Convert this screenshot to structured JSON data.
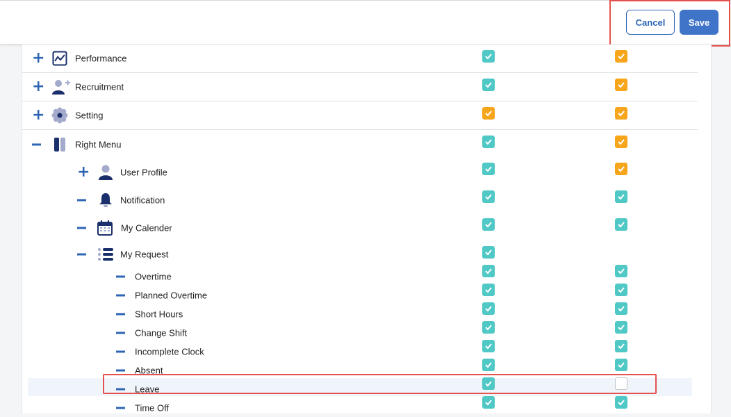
{
  "header": {
    "cancel_label": "Cancel",
    "save_label": "Save"
  },
  "colors": {
    "primary": "#3f74c8",
    "teal_checked": "#4fc8c6",
    "orange_checked": "#f7a51b",
    "highlight_red": "#e4514f"
  },
  "rows": [
    {
      "label": "Performance",
      "toggle": "plus",
      "icon": "chart-icon",
      "col1": "teal",
      "col2": "orange"
    },
    {
      "label": "Recruitment",
      "toggle": "plus",
      "icon": "add-user-icon",
      "col1": "teal",
      "col2": "orange"
    },
    {
      "label": "Setting",
      "toggle": "plus",
      "icon": "gear-icon",
      "col1": "orange",
      "col2": "orange"
    },
    {
      "label": "Right Menu",
      "toggle": "minus",
      "icon": "sidebar-icon",
      "col1": "teal",
      "col2": "orange"
    },
    {
      "label": "User Profile",
      "toggle": "plus",
      "icon": "user-icon",
      "col1": "teal",
      "col2": "orange"
    },
    {
      "label": "Notification",
      "toggle": "minus",
      "icon": "bell-icon",
      "col1": "teal",
      "col2": "teal"
    },
    {
      "label": "My Calender",
      "toggle": "minus",
      "icon": "calendar-icon",
      "col1": "teal",
      "col2": "teal"
    },
    {
      "label": "My Request",
      "toggle": "minus",
      "icon": "list-icon",
      "col1": "teal",
      "col2": "none"
    },
    {
      "label": "Overtime",
      "toggle": "minus",
      "col1": "teal",
      "col2": "teal"
    },
    {
      "label": "Planned Overtime",
      "toggle": "minus",
      "col1": "teal",
      "col2": "teal"
    },
    {
      "label": "Short Hours",
      "toggle": "minus",
      "col1": "teal",
      "col2": "teal"
    },
    {
      "label": "Change Shift",
      "toggle": "minus",
      "col1": "teal",
      "col2": "teal"
    },
    {
      "label": "Incomplete Clock",
      "toggle": "minus",
      "col1": "teal",
      "col2": "teal"
    },
    {
      "label": "Absent",
      "toggle": "minus",
      "col1": "teal",
      "col2": "teal"
    },
    {
      "label": "Leave",
      "toggle": "minus",
      "col1": "teal",
      "col2": "empty"
    },
    {
      "label": "Time Off",
      "toggle": "minus",
      "col1": "teal",
      "col2": "teal"
    }
  ]
}
